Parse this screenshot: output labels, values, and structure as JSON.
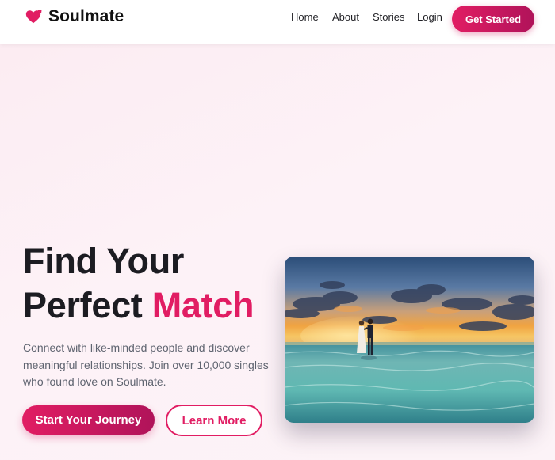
{
  "brand": {
    "name": "Soulmate",
    "icon": "heart-arrow-icon",
    "accent_color": "#e11d63"
  },
  "nav": {
    "items": [
      {
        "label": "Home"
      },
      {
        "label": "About"
      },
      {
        "label": "Stories"
      },
      {
        "label": "Login"
      }
    ],
    "cta_label": "Get Started"
  },
  "hero": {
    "headline_line1": "Find Your",
    "headline_line2_prefix": "Perfect ",
    "headline_accent": "Match",
    "subtext": "Connect with like-minded people and discover meaningful relationships. Join over 10,000 singles who found love on Soulmate.",
    "primary_cta": "Start Your Journey",
    "secondary_cta": "Learn More",
    "image": "couple-on-beach-at-sunset-photo"
  }
}
